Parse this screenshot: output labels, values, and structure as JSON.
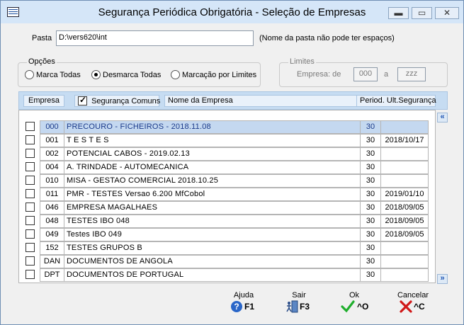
{
  "window": {
    "title": "Segurança Periódica Obrigatória - Seleção de Empresas",
    "buttons": [
      "minimize",
      "maximize",
      "close"
    ]
  },
  "pasta": {
    "label": "Pasta",
    "value": "D:\\vers620\\int",
    "hint": "(Nome da pasta não pode ter espaços)"
  },
  "opcoes": {
    "legend": "Opções",
    "options": [
      {
        "label": "Marca Todas",
        "selected": false
      },
      {
        "label": "Desmarca Todas",
        "selected": true
      },
      {
        "label": "Marcação por Limites",
        "selected": false
      }
    ]
  },
  "limites": {
    "legend": "Limites",
    "label_de": "Empresa: de",
    "de_value": "000",
    "label_a": "a",
    "a_value": "zzz"
  },
  "grid_header": {
    "empresa": "Empresa",
    "seguranca_comuns": "Segurança Comuns",
    "seguranca_comuns_checked": true,
    "nome": "Nome da Empresa",
    "period": "Period. Ult.Segurança"
  },
  "rows": [
    {
      "code": "000",
      "name": "PRECOURO - FICHEIROS -  2018.11.08",
      "period": "30",
      "date": "",
      "selected": true
    },
    {
      "code": "001",
      "name": "T E S T E S",
      "period": "30",
      "date": "2018/10/17",
      "selected": false
    },
    {
      "code": "002",
      "name": "POTENCIAL CABOS -  2019.02.13",
      "period": "30",
      "date": "",
      "selected": false
    },
    {
      "code": "004",
      "name": "A. TRINDADE - AUTOMECANICA",
      "period": "30",
      "date": "",
      "selected": false
    },
    {
      "code": "010",
      "name": "MISA -  GESTAO COMERCIAL    2018.10.25",
      "period": "30",
      "date": "",
      "selected": false
    },
    {
      "code": "011",
      "name": "PMR - TESTES Versao 6.200 MfCobol",
      "period": "30",
      "date": "2019/01/10",
      "selected": false
    },
    {
      "code": "046",
      "name": "EMPRESA MAGALHAES",
      "period": "30",
      "date": "2018/09/05",
      "selected": false
    },
    {
      "code": "048",
      "name": "TESTES IBO  048",
      "period": "30",
      "date": "2018/09/05",
      "selected": false
    },
    {
      "code": "049",
      "name": "Testes IBO 049",
      "period": "30",
      "date": "2018/09/05",
      "selected": false
    },
    {
      "code": "152",
      "name": "TESTES GRUPOS B",
      "period": "30",
      "date": "",
      "selected": false
    },
    {
      "code": "DAN",
      "name": "DOCUMENTOS DE ANGOLA",
      "period": "30",
      "date": "",
      "selected": false
    },
    {
      "code": "DPT",
      "name": "DOCUMENTOS DE PORTUGAL",
      "period": "30",
      "date": "",
      "selected": false
    }
  ],
  "footer": {
    "ajuda": {
      "label": "Ajuda",
      "key": "F1",
      "icon": "help-icon"
    },
    "sair": {
      "label": "Sair",
      "key": "F3",
      "icon": "exit-icon"
    },
    "ok": {
      "label": "Ok",
      "key": "^O",
      "icon": "check-icon"
    },
    "cancelar": {
      "label": "Cancelar",
      "key": "^C",
      "icon": "cross-icon"
    }
  },
  "colors": {
    "selected_row_bg": "#c4d8f0",
    "selected_row_text": "#1b3a8a",
    "header_bar": "#c6dcf2",
    "ok_green": "#1fae2c",
    "cancel_red": "#d01818",
    "help_blue": "#2a66c8"
  }
}
